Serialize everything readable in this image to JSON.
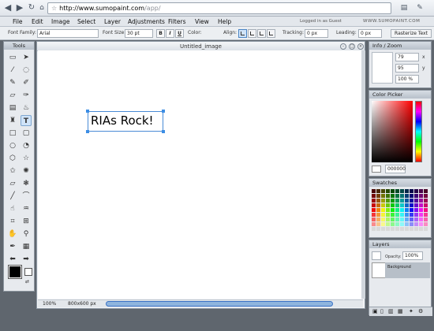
{
  "browser": {
    "url_host": "http://www.sumopaint.com",
    "url_path": "/app/"
  },
  "menu": [
    "File",
    "Edit",
    "Image",
    "Select",
    "Layer",
    "Adjustments",
    "Filters",
    "View",
    "Help"
  ],
  "login_status": "Logged in as Guest",
  "brand": "WWW.SUMOPAINT.COM",
  "options": {
    "font_family_label": "Font Family:",
    "font_family_value": "Arial",
    "font_size_label": "Font Size:",
    "font_size_value": "30 pt",
    "bold": "B",
    "italic": "I",
    "underline": "U",
    "color_label": "Color:",
    "color_value": "#000000",
    "align_label": "Align:",
    "tracking_label": "Tracking:",
    "tracking_value": "0 px",
    "leading_label": "Leading:",
    "leading_value": "0 px",
    "rasterize_button": "Rasterize Text"
  },
  "tools_panel": {
    "title": "Tools"
  },
  "document": {
    "title": "Untitled_image",
    "canvas_text": "RIAs Rock!",
    "zoom": "100%",
    "size": "800x600 px"
  },
  "info_panel": {
    "title": "Info / Zoom",
    "x_value": "79",
    "x_label": "x",
    "y_value": "95",
    "y_label": "y",
    "zoom_value": "100 %"
  },
  "color_picker": {
    "title": "Color Picker",
    "hex_value": "000000"
  },
  "swatches": {
    "title": "Swatches"
  },
  "layers": {
    "title": "Layers",
    "opacity_label": "Opacity:",
    "opacity_value": "100%",
    "layer_name": "Background"
  }
}
